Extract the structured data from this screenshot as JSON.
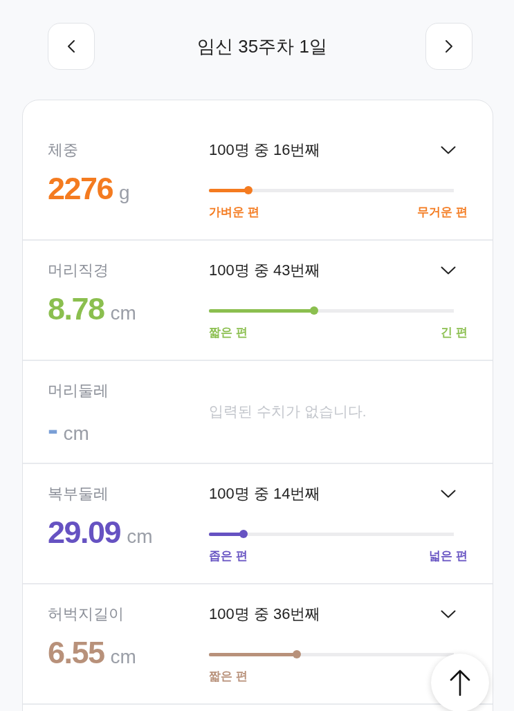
{
  "header": {
    "title": "임신 35주차 1일"
  },
  "measurements": [
    {
      "kind": "ranked",
      "label": "체중",
      "value": "2276",
      "unit": "g",
      "color": "#f47b20",
      "rank": "100명 중 16번째",
      "expanded": false,
      "level": 0.16,
      "min_label": "가벼운 편",
      "max_label": "무거운 편"
    },
    {
      "kind": "ranked",
      "label": "머리직경",
      "value": "8.78",
      "unit": "cm",
      "color": "#8bbf4f",
      "rank": "100명 중 43번째",
      "expanded": false,
      "level": 0.43,
      "min_label": "짧은 편",
      "max_label": "긴 편"
    },
    {
      "kind": "empty",
      "label": "머리둘레",
      "value": "-",
      "unit": "cm",
      "color": "#7a9fd6",
      "message": "입력된 수치가 없습니다."
    },
    {
      "kind": "ranked",
      "label": "복부둘레",
      "value": "29.09",
      "unit": "cm",
      "color": "#6652c2",
      "rank": "100명 중 14번째",
      "expanded": false,
      "level": 0.14,
      "min_label": "좁은 편",
      "max_label": "넓은 편"
    },
    {
      "kind": "ranked",
      "label": "허벅지길이",
      "value": "6.55",
      "unit": "cm",
      "color": "#b8917a",
      "rank": "100명 중 36번째",
      "expanded": false,
      "level": 0.36,
      "min_label": "짧은 편"
    }
  ]
}
